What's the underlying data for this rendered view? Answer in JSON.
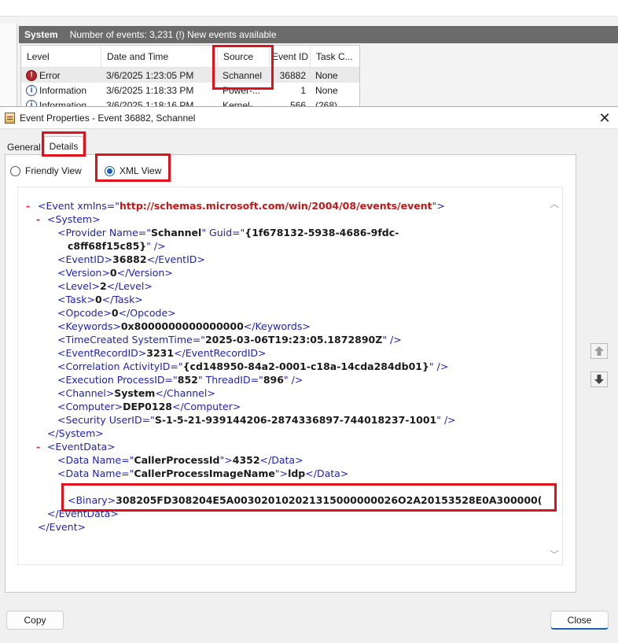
{
  "event_viewer": {
    "header_label": "System",
    "header_info": "Number of events: 3,231 (!) New events available",
    "columns": [
      "Level",
      "Date and Time",
      "Source",
      "Event ID",
      "Task C..."
    ],
    "rows": [
      {
        "level": "Error",
        "date": "3/6/2025 1:23:05 PM",
        "source": "Schannel",
        "event_id": "36882",
        "task": "None"
      },
      {
        "level": "Information",
        "date": "3/6/2025 1:18:33 PM",
        "source": "Power-...",
        "event_id": "1",
        "task": "None"
      },
      {
        "level": "Information",
        "date": "3/6/2025 1:18:16 PM",
        "source": "Kernel-...",
        "event_id": "566",
        "task": "(268)"
      }
    ]
  },
  "dialog": {
    "title": "Event Properties - Event 36882, Schannel",
    "tabs": [
      "General",
      "Details"
    ],
    "view_options": {
      "friendly": "Friendly View",
      "xml": "XML View"
    },
    "buttons": {
      "copy": "Copy",
      "close": "Close"
    }
  },
  "xml": {
    "event_open": "<Event xmlns=\"",
    "event_ns": "http://schemas.microsoft.com/win/2004/08/events/event",
    "event_open_end": "\">",
    "system_open": "<System>",
    "provider_pre": "<Provider Name=\"",
    "provider_name": "Schannel",
    "provider_mid": "\" Guid=\"",
    "provider_guid_1": "{1f678132-5938-4686-9fdc-",
    "provider_guid_2": "c8ff68f15c85}",
    "provider_end": "\" />",
    "eventid_open": "<EventID>",
    "eventid_val": "36882",
    "eventid_close": "</EventID>",
    "version_open": "<Version>",
    "version_val": "0",
    "version_close": "</Version>",
    "level_open": "<Level>",
    "level_val": "2",
    "level_close": "</Level>",
    "task_open": "<Task>",
    "task_val": "0",
    "task_close": "</Task>",
    "opcode_open": "<Opcode>",
    "opcode_val": "0",
    "opcode_close": "</Opcode>",
    "keywords_open": "<Keywords>",
    "keywords_val": "0x8000000000000000",
    "keywords_close": "</Keywords>",
    "timecreated_pre": "<TimeCreated SystemTime=\"",
    "timecreated_val": "2025-03-06T19:23:05.1872890Z",
    "timecreated_end": "\" />",
    "recordid_open": "<EventRecordID>",
    "recordid_val": "3231",
    "recordid_close": "</EventRecordID>",
    "correlation_pre": "<Correlation ActivityID=\"",
    "correlation_val": "{cd148950-84a2-0001-c18a-14cda284db01}",
    "correlation_end": "\" />",
    "execution_pre": "<Execution ProcessID=\"",
    "execution_pid": "852",
    "execution_mid": "\" ThreadID=\"",
    "execution_tid": "896",
    "execution_end": "\" />",
    "channel_open": "<Channel>",
    "channel_val": "System",
    "channel_close": "</Channel>",
    "computer_open": "<Computer>",
    "computer_val": "DEP0128",
    "computer_close": "</Computer>",
    "security_pre": "<Security UserID=\"",
    "security_val": "S-1-5-21-939144206-2874336897-744018237-1001",
    "security_end": "\" />",
    "system_close": "</System>",
    "eventdata_open": "<EventData>",
    "data1_pre": "<Data Name=\"",
    "data1_name": "CallerProcessId",
    "data1_mid": "\">",
    "data1_val": "4352",
    "data1_close": "</Data>",
    "data2_pre": "<Data Name=\"",
    "data2_name": "CallerProcessImageName",
    "data2_mid": "\">",
    "data2_val": "ldp",
    "data2_close": "</Data>",
    "binary_open": "<Binary>",
    "binary_val": "308205FD308204E5A003020102021315000000026O2A20153528E0A300000(",
    "eventdata_close": "</EventData>",
    "event_close": "</Event>",
    "dash": "-"
  },
  "colors": {
    "highlight": "#e0111b",
    "tag": "#2222b8",
    "namespace": "#c41818",
    "accent": "#1a5fb4"
  }
}
